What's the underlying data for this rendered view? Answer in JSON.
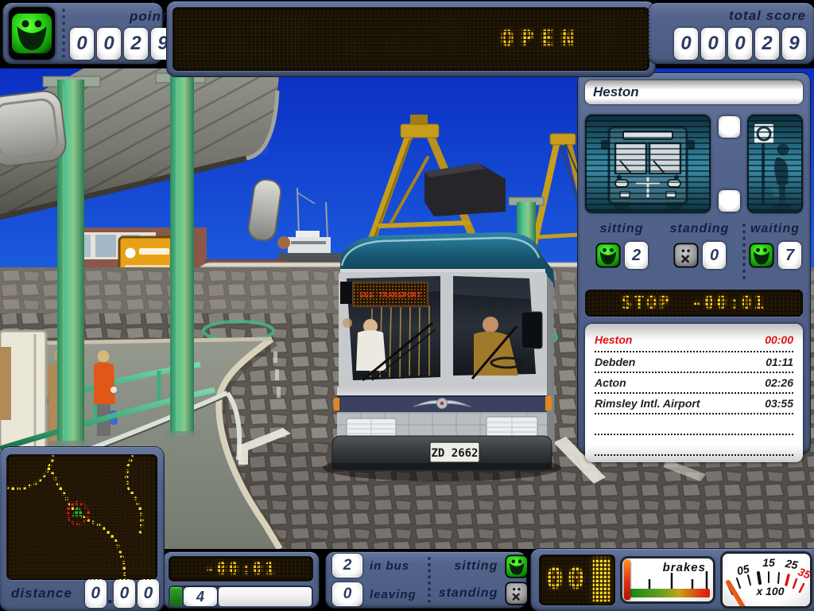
{
  "header": {
    "points_label": "points",
    "points_digits": [
      "0",
      "0",
      "2",
      "9"
    ],
    "door_display": "OPEN",
    "total_score_label": "total score",
    "total_score_digits": [
      "0",
      "0",
      "0",
      "2",
      "9"
    ]
  },
  "scene": {
    "bus": {
      "destination_sign": "SGS TRANSPORT",
      "license_plate": "ZD 2662"
    }
  },
  "stop_panel": {
    "stop_name": "Heston",
    "sitting_label": "sitting",
    "sitting_count": "2",
    "standing_label": "standing",
    "standing_count": "0",
    "waiting_label": "waiting",
    "waiting_count": "7",
    "stop_timer": "STOP -00:01",
    "schedule": [
      {
        "name": "Heston",
        "time": "00:00"
      },
      {
        "name": "Debden",
        "time": "01:11"
      },
      {
        "name": "Acton",
        "time": "02:26"
      },
      {
        "name": "Rimsley Intl. Airport",
        "time": "03:55"
      },
      {
        "name": "",
        "time": ""
      },
      {
        "name": "",
        "time": ""
      }
    ]
  },
  "minimap": {
    "distance_label": "distance",
    "distance_digits": [
      "0",
      ".",
      "0",
      "0"
    ]
  },
  "bottom_bar": {
    "timer_display": "-00:01",
    "route_progress_value": "4",
    "in_bus_count": "2",
    "in_bus_label": "in bus",
    "leaving_count": "0",
    "leaving_label": "leaving",
    "sitting_label": "sitting",
    "standing_label": "standing",
    "speed_display": "00",
    "brakes_label": "brakes",
    "speedometer_labels": [
      "05",
      "15",
      "25",
      "35"
    ],
    "speedometer_multiplier": "x 100"
  },
  "colors": {
    "panel_blue": "#53648c",
    "led_yellow": "#ffd41a",
    "schedule_highlight_red": "#e01010",
    "smiley_green": "#27d214",
    "standing_gray": "#9a9a9a",
    "map_road_yellow": "#ffe21e",
    "sky_top": "#0a2fc2",
    "sky_bottom": "#47a0f0",
    "crane_yellow": "#c79d1c"
  }
}
